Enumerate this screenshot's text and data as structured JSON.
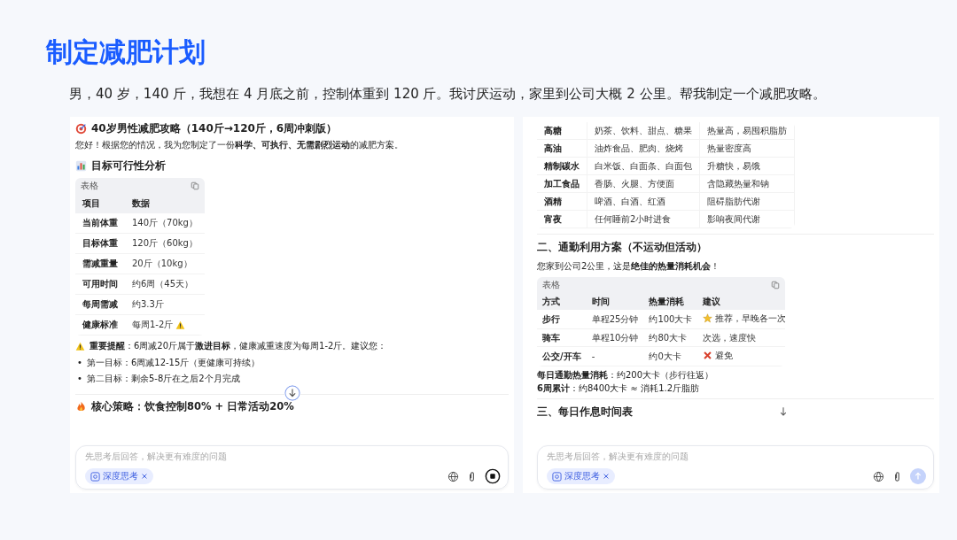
{
  "slide": {
    "title": "制定减肥计划",
    "prompt": "男，40 岁，140 斤，我想在 4 月底之前，控制体重到 120 斤。我讨厌运动，家里到公司大概 2 公里。帮我制定一个减肥攻略。"
  },
  "left_panel": {
    "title": "40岁男性减肥攻略（140斤→120斤，6周冲刺版）",
    "intro": "您好！根据您的情况，我为您制定了一份**科学、可执行、无需剧烈运动**的减肥方案。",
    "section": "目标可行性分析",
    "table": {
      "caption": "表格",
      "columns": [
        "项目",
        "数据"
      ],
      "rows": [
        {
          "cells": [
            "当前体重",
            "140斤（70kg）"
          ],
          "warning": false
        },
        {
          "cells": [
            "目标体重",
            "120斤（60kg）"
          ],
          "warning": false
        },
        {
          "cells": [
            "需减重量",
            "20斤（10kg）"
          ],
          "warning": false
        },
        {
          "cells": [
            "可用时间",
            "约6周（45天）"
          ],
          "warning": false
        },
        {
          "cells": [
            "每周需减",
            "约3.3斤"
          ],
          "warning": false
        },
        {
          "cells": [
            "健康标准",
            "每周1-2斤"
          ],
          "warning": true
        }
      ]
    },
    "notice": "**重要提醒**：6周减20斤属于**激进目标**，健康减重速度为每周1-2斤。建议您：",
    "bullets": [
      {
        "marker": "•",
        "text": "第一目标：6周减12-15斤（更健康可持续）"
      },
      {
        "marker": "•",
        "text": "第二目标：剩余5-8斤在之后2个月完成"
      }
    ],
    "next_section": "核心策略：饮食控制80% + 日常活动20%",
    "input": {
      "placeholder": "先思考后回答，解决更有难度的问题",
      "chip": "深度思考",
      "generating": true
    }
  },
  "right_panel": {
    "top_table": {
      "rows": [
        {
          "cells": [
            "高糖",
            "奶茶、饮料、甜点、糖果",
            "热量高，易囤积脂肪"
          ]
        },
        {
          "cells": [
            "高油",
            "油炸食品、肥肉、烧烤",
            "热量密度高"
          ]
        },
        {
          "cells": [
            "精制碳水",
            "白米饭、白面条、白面包",
            "升糖快，易饿"
          ]
        },
        {
          "cells": [
            "加工食品",
            "香肠、火腿、方便面",
            "含隐藏热量和钠"
          ]
        },
        {
          "cells": [
            "酒精",
            "啤酒、白酒、红酒",
            "阻碍脂肪代谢"
          ]
        },
        {
          "cells": [
            "宵夜",
            "任何睡前2小时进食",
            "影响夜间代谢"
          ]
        }
      ]
    },
    "section": "二、通勤利用方案（不运动但活动）",
    "intro": "您家到公司2公里，这是**绝佳的热量消耗机会**！",
    "table": {
      "caption": "表格",
      "columns": [
        "方式",
        "时间",
        "热量消耗",
        "建议"
      ],
      "rows": [
        {
          "cells": [
            "步行",
            "单程25分钟",
            "约100大卡",
            "推荐，早晚各一次"
          ],
          "star": true,
          "cross": false
        },
        {
          "cells": [
            "骑车",
            "单程10分钟",
            "约80大卡",
            "次选，速度快"
          ],
          "star": false,
          "cross": false
        },
        {
          "cells": [
            "公交/开车",
            "-",
            "约0大卡",
            "避免"
          ],
          "star": false,
          "cross": true
        }
      ]
    },
    "summary": [
      "**每日通勤热量消耗**：约200大卡（步行往返）",
      "**6周累计**：约8400大卡 ≈ 消耗1.2斤脂肪"
    ],
    "next_section": "三、每日作息时间表",
    "input": {
      "placeholder": "先思考后回答，解决更有难度的问题",
      "chip": "深度思考",
      "generating": false
    }
  }
}
